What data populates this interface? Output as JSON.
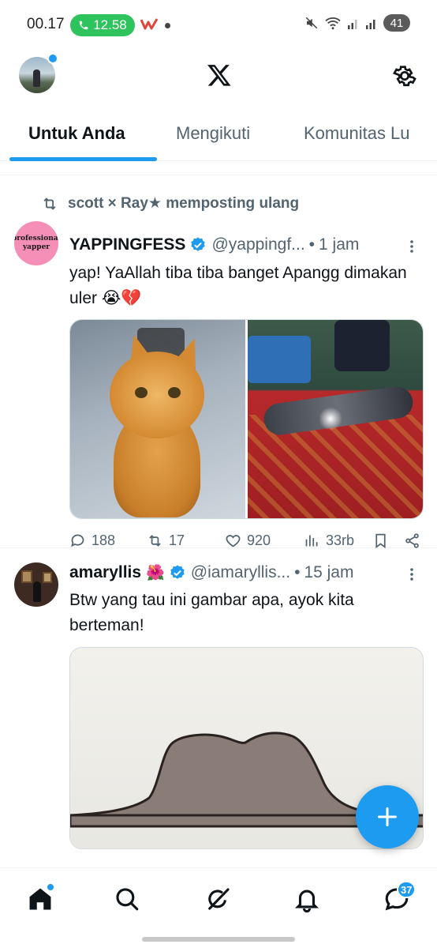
{
  "status_bar": {
    "time": "00.17",
    "call_duration": "12.58",
    "battery": "41"
  },
  "header": {
    "logo": "x-logo",
    "settings_icon": "gear-icon"
  },
  "tabs": [
    {
      "label": "Untuk Anda",
      "active": true
    },
    {
      "label": "Mengikuti",
      "active": false
    },
    {
      "label": "Komunitas Lu",
      "active": false
    }
  ],
  "posts": [
    {
      "reposted_by": "scott × Ray★ memposting ulang",
      "name": "YAPPINGFESS",
      "verified": true,
      "handle": "@yappingf...",
      "time": "1 jam",
      "avatar_text_1": "professional",
      "avatar_text_2": "yapper",
      "text": "yap! YaAllah tiba tiba banget Apangg dimakan uler 😭💔",
      "stats": {
        "replies": "188",
        "reposts": "17",
        "likes": "920",
        "views": "33rb"
      }
    },
    {
      "name": "amaryllis",
      "emoji": "🌺",
      "verified": true,
      "handle": "@iamaryllis...",
      "time": "15 jam",
      "text": "Btw yang tau ini gambar apa, ayok kita berteman!"
    }
  ],
  "bottom_nav": {
    "items": [
      "home-icon",
      "search-icon",
      "grok-icon",
      "notifications-icon",
      "messages-icon"
    ],
    "messages_badge": "37"
  },
  "colors": {
    "accent": "#1d9bf0",
    "text_primary": "#0f1419",
    "text_secondary": "#536471"
  }
}
